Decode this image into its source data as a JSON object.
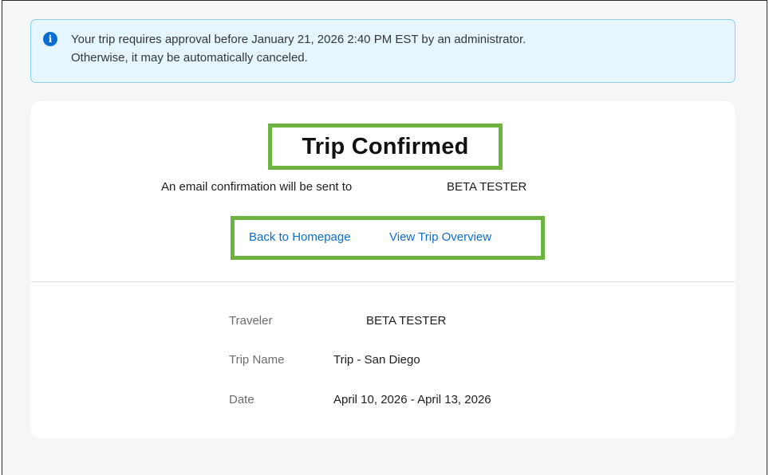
{
  "alert": {
    "icon": "info-icon",
    "line1": "Your trip requires approval before January 21, 2026 2:40 PM EST by an administrator.",
    "line2": "Otherwise, it may be automatically canceled."
  },
  "confirmation": {
    "title": "Trip Confirmed",
    "email_label": "An email confirmation will be sent to",
    "email_recipient": "BETA TESTER"
  },
  "links": {
    "back_to_homepage": "Back to Homepage",
    "view_trip_overview": "View Trip Overview"
  },
  "details": {
    "traveler_label": "Traveler",
    "traveler_value": "BETA TESTER",
    "trip_name_label": "Trip Name",
    "trip_name_value": "Trip - San Diego",
    "date_label": "Date",
    "date_value": "April 10, 2026 - April 13, 2026"
  },
  "colors": {
    "accent_link": "#0a6ed1",
    "highlight_box": "#6cb33f",
    "alert_background": "#e6f6fe",
    "alert_border": "#89cfee"
  }
}
